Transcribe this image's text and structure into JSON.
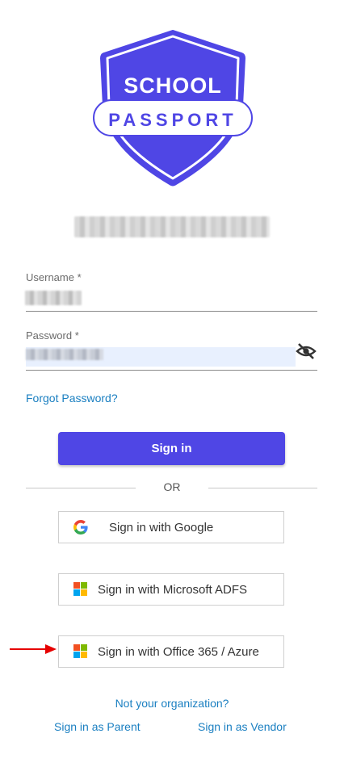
{
  "logo": {
    "line1": "SCHOOL",
    "line2": "PASSPORT",
    "color": "#4f46e5"
  },
  "username": {
    "label": "Username *"
  },
  "password": {
    "label": "Password *"
  },
  "forgot_password": "Forgot Password?",
  "sign_in_button": "Sign in",
  "divider_text": "OR",
  "sso": {
    "google": "Sign in with Google",
    "adfs": "Sign in with Microsoft ADFS",
    "office365": "Sign in with Office 365 / Azure"
  },
  "footer": {
    "not_your_org": "Not your organization?",
    "parent": "Sign in as Parent",
    "vendor": "Sign in as Vendor"
  },
  "colors": {
    "accent": "#4f46e5",
    "link": "#1a7fc1",
    "arrow": "#e60000"
  }
}
